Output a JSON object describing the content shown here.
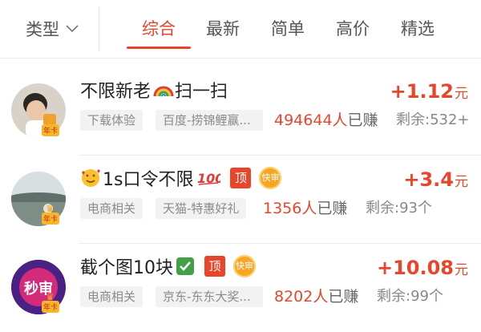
{
  "filter_bar": {
    "type_dropdown": "类型",
    "tabs": [
      "综合",
      "最新",
      "简单",
      "高价",
      "精选"
    ],
    "active_tab": "综合",
    "accent_color": "#e8452a"
  },
  "tasks": [
    {
      "title": "不限新老",
      "title_icons": [
        "rainbow-icon"
      ],
      "title_suffix": "扫一扫",
      "badges": [],
      "reward_value": "+1.12",
      "reward_unit": "元",
      "category": "下载体验",
      "merchant": "百度-捞锦鲤赢...",
      "earned_count": "494644人",
      "earned_label": "已赚",
      "remaining": "剩余:532+",
      "vip_tag": "年卡"
    },
    {
      "title_prefix_icon": "smiling-face-with-hearts-icon",
      "title": "1s口令不限",
      "title_icons": [
        "hundred-points-icon"
      ],
      "badges": [
        "顶",
        "快审"
      ],
      "reward_value": "+3.4",
      "reward_unit": "元",
      "category": "电商相关",
      "merchant": "天猫-特惠好礼",
      "earned_count": "1356人",
      "earned_label": "已赚",
      "remaining": "剩余:93个",
      "vip_tag": "年卡"
    },
    {
      "title": "截个图10块",
      "title_icons": [
        "check-mark-icon"
      ],
      "badges": [
        "顶",
        "快审"
      ],
      "reward_value": "+10.08",
      "reward_unit": "元",
      "category": "电商相关",
      "merchant": "京东-东东大奖...",
      "earned_count": "8202人",
      "earned_label": "已赚",
      "remaining": "剩余:99个",
      "vip_tag": "年卡",
      "avatar_text": "秒审"
    }
  ]
}
